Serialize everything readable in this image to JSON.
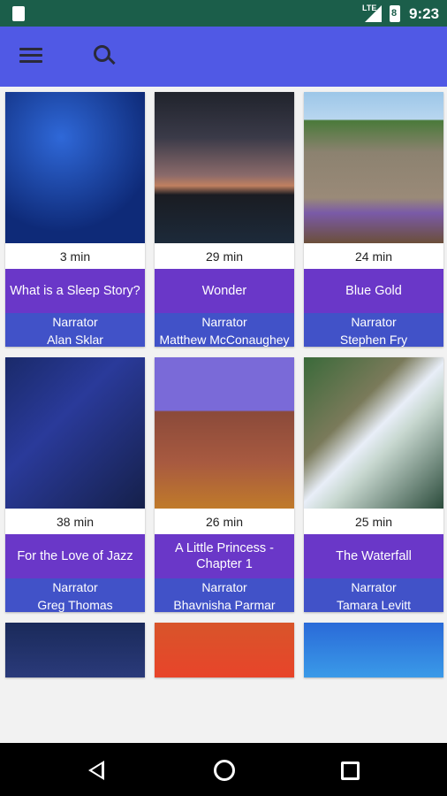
{
  "status_bar": {
    "network": "LTE",
    "battery_level": "8",
    "time": "9:23"
  },
  "app_bar": {
    "menu_icon": "hamburger-menu-icon",
    "search_icon": "search-icon"
  },
  "stories": [
    {
      "duration": "3 min",
      "title": "What is a Sleep Story?",
      "narrator_label": "Narrator",
      "narrator": "Alan Sklar"
    },
    {
      "duration": "29 min",
      "title": "Wonder",
      "narrator_label": "Narrator",
      "narrator": "Matthew McConaughey"
    },
    {
      "duration": "24 min",
      "title": "Blue Gold",
      "narrator_label": "Narrator",
      "narrator": "Stephen Fry"
    },
    {
      "duration": "38 min",
      "title": "For the Love of Jazz",
      "narrator_label": "Narrator",
      "narrator": "Greg Thomas"
    },
    {
      "duration": "26 min",
      "title": "A Little Princess - Chapter 1",
      "narrator_label": "Narrator",
      "narrator": "Bhavnisha Parmar"
    },
    {
      "duration": "25 min",
      "title": "The Waterfall",
      "narrator_label": "Narrator",
      "narrator": "Tamara Levitt"
    }
  ],
  "nav_bar": {
    "back_icon": "back-triangle-icon",
    "home_icon": "home-circle-icon",
    "recents_icon": "recents-square-icon"
  },
  "colors": {
    "status_bar": "#1b5e4a",
    "app_bar": "#5059e5",
    "title_band": "#6a37c8",
    "narrator_band": "#4152c8"
  }
}
